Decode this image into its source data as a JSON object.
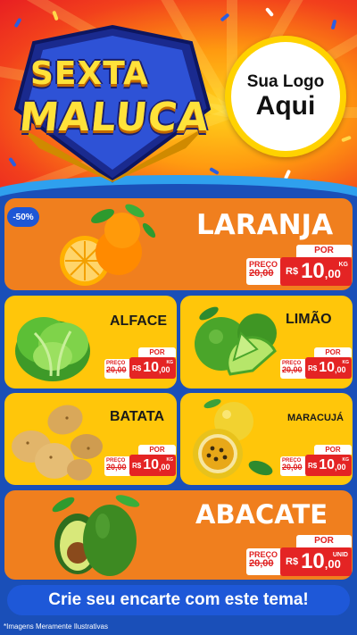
{
  "header": {
    "title_line1": "SEXTA",
    "title_line2": "MALUCA",
    "logo_line1": "Sua Logo",
    "logo_line2": "Aqui"
  },
  "discount_badge": "-50%",
  "products": [
    {
      "name": "LARANJA",
      "label_de": "PREÇO",
      "old_price": "20,00",
      "label_por": "POR",
      "currency": "R$",
      "price_int": "10",
      "price_dec": ",00",
      "unit": "KG"
    },
    {
      "name": "ALFACE",
      "label_de": "PREÇO",
      "old_price": "20,00",
      "label_por": "POR",
      "currency": "R$",
      "price_int": "10",
      "price_dec": ",00",
      "unit": "KG"
    },
    {
      "name": "LIMÃO",
      "label_de": "PREÇO",
      "old_price": "20,00",
      "label_por": "POR",
      "currency": "R$",
      "price_int": "10",
      "price_dec": ",00",
      "unit": "KG"
    },
    {
      "name": "BATATA",
      "label_de": "PREÇO",
      "old_price": "20,00",
      "label_por": "POR",
      "currency": "R$",
      "price_int": "10",
      "price_dec": ",00",
      "unit": "KG"
    },
    {
      "name": "MARACUJÁ",
      "label_de": "PREÇO",
      "old_price": "20,00",
      "label_por": "POR",
      "currency": "R$",
      "price_int": "10",
      "price_dec": ",00",
      "unit": "KG"
    },
    {
      "name": "ABACATE",
      "label_de": "PREÇO",
      "old_price": "20,00",
      "label_por": "POR",
      "currency": "R$",
      "price_int": "10",
      "price_dec": ",00",
      "unit": "UNID"
    }
  ],
  "cta": "Crie seu encarte com este tema!",
  "disclaimer": "*Imagens Meramente Ilustrativas",
  "colors": {
    "page_bg": "#1a4fb8",
    "card_yellow": "#ffc60a",
    "card_orange": "#f07f1e",
    "price_red": "#e42424",
    "cta_blue": "#1e58d8",
    "title_yellow": "#ffe23a"
  }
}
